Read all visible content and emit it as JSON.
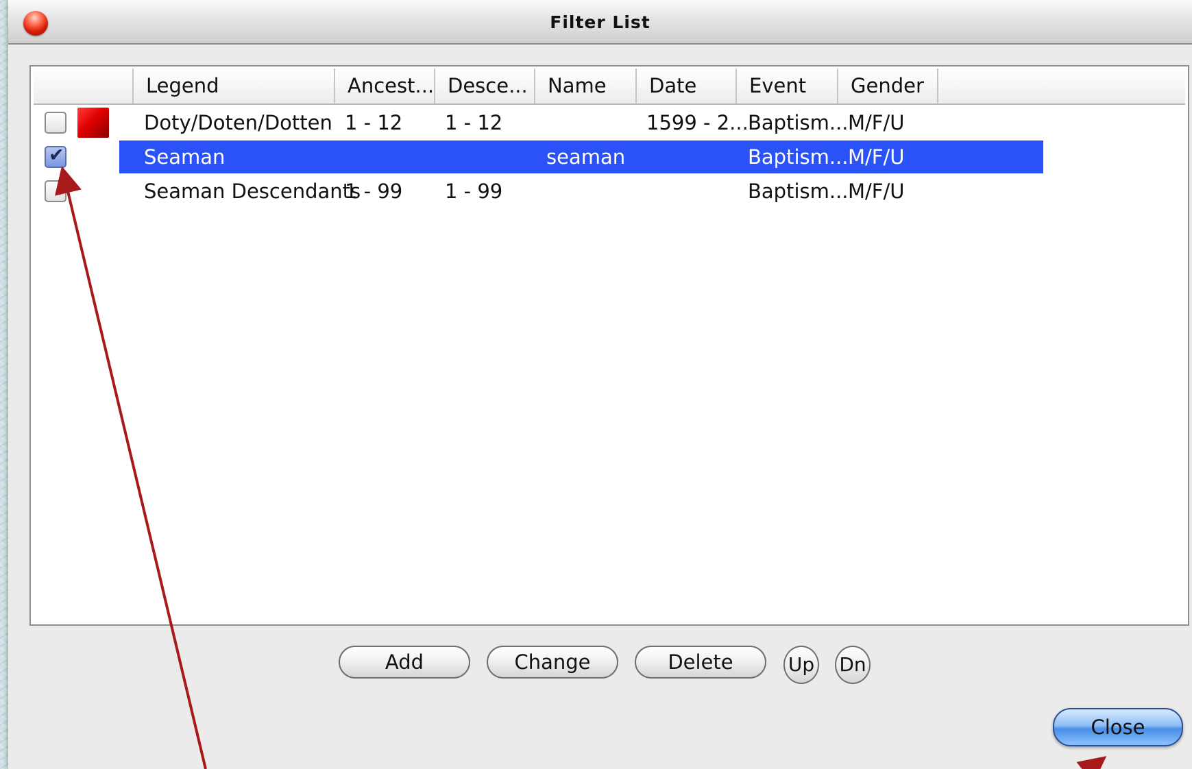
{
  "window": {
    "title": "Filter List"
  },
  "table": {
    "columns": [
      "Legend",
      "Ancest...",
      "Desce...",
      "Name",
      "Date",
      "Event",
      "Gender"
    ],
    "rows": [
      {
        "checked": false,
        "swatch": "#e00000",
        "legend": "Doty/Doten/Dotten",
        "ancestors": "1 - 12",
        "descendants": "1 - 12",
        "name": "",
        "date": "1599 - 2...",
        "event": "Baptism...",
        "gender": "M/F/U",
        "selected": false
      },
      {
        "checked": true,
        "swatch": "",
        "legend": "Seaman",
        "ancestors": "",
        "descendants": "",
        "name": "seaman",
        "date": "",
        "event": "Baptism...",
        "gender": "M/F/U",
        "selected": true
      },
      {
        "checked": false,
        "swatch": "",
        "legend": "Seaman Descendants",
        "ancestors": "1 - 99",
        "descendants": "1 - 99",
        "name": "",
        "date": "",
        "event": "Baptism...",
        "gender": "M/F/U",
        "selected": false
      }
    ]
  },
  "buttons": {
    "add": "Add",
    "change": "Change",
    "delete": "Delete",
    "up": "Up",
    "down": "Dn",
    "close": "Close"
  },
  "colors": {
    "selection": "#2a52f6",
    "annotation_arrow": "#a8191c",
    "close_button": "#4a8ee6"
  }
}
